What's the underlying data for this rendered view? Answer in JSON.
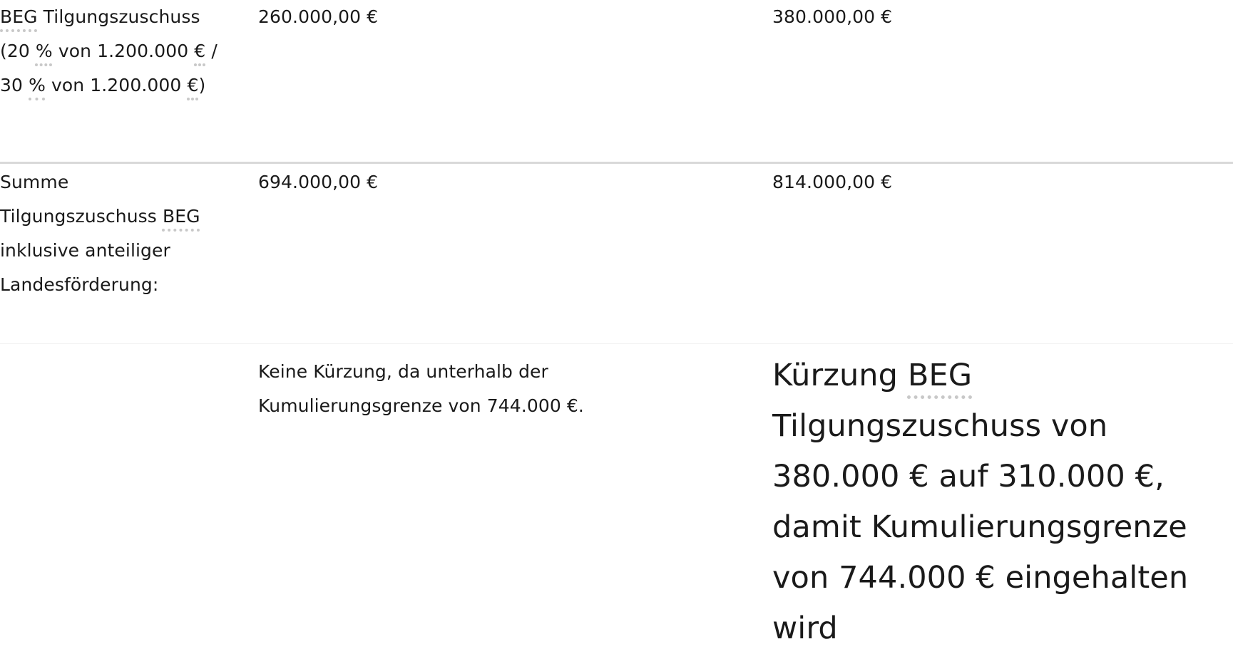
{
  "rows": [
    {
      "label_parts": [
        "BEG",
        " Tilgungszuschuss (20 ",
        "%",
        " von 1.200.000 ",
        "€",
        " / 30 ",
        "%",
        " von 1.200.000 ",
        "€",
        ")"
      ],
      "col2": "260.000,00 €",
      "col3": "380.000,00 €"
    },
    {
      "label_parts": [
        "Summe Tilgungszuschuss ",
        "BEG",
        " inklusive anteiliger Landesförderung:"
      ],
      "col2": "694.000,00 €",
      "col3": "814.000,00 €"
    },
    {
      "label": "",
      "col2": "Keine Kürzung, da unterhalb der Kumulierungsgrenze von 744.000 €.",
      "col3_parts": [
        "Kürzung ",
        "BEG",
        " Tilgungszuschuss von 380.000 € auf 310.000 €, damit Kumulierungsgrenze von 744.000 € eingehalten wird"
      ]
    }
  ]
}
